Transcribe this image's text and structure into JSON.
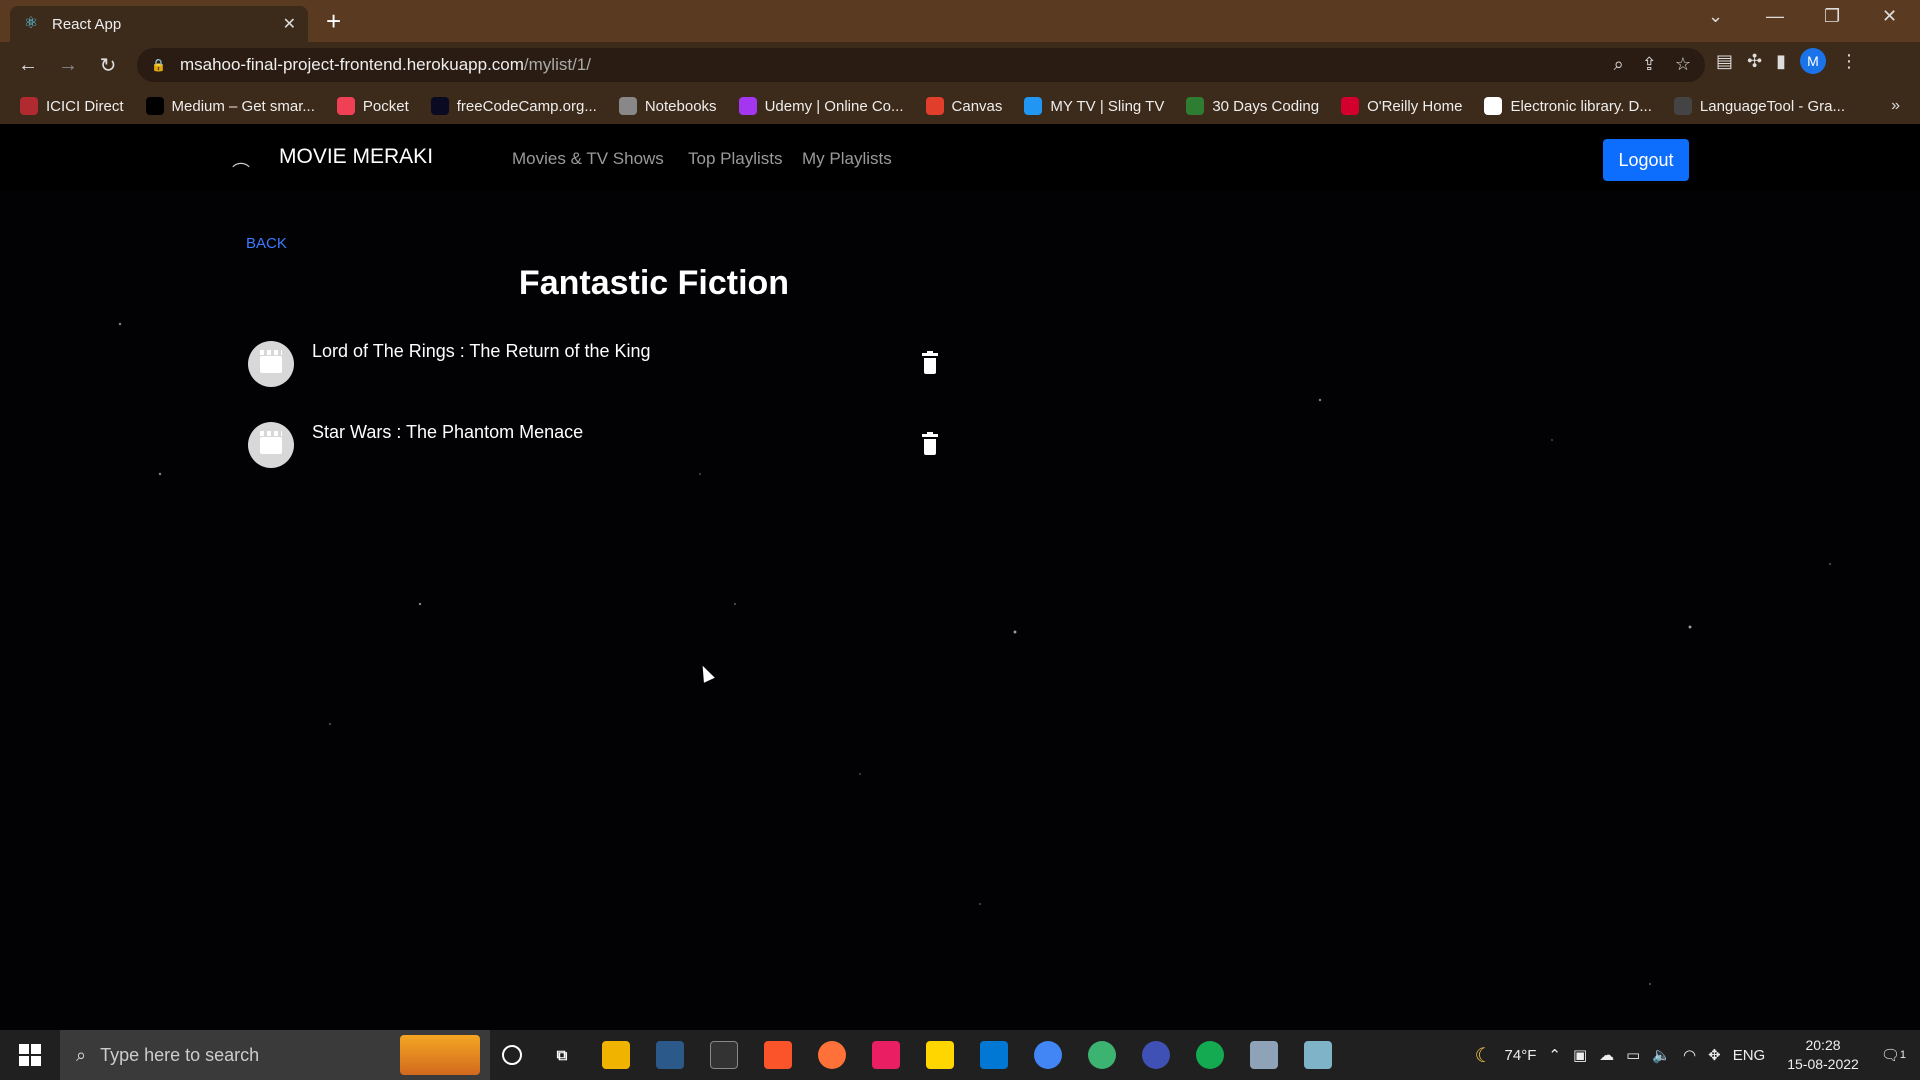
{
  "browser": {
    "tab_title": "React App",
    "url_host": "msahoo-final-project-frontend.herokuapp.com",
    "url_path": "/mylist/1/",
    "profile_initial": "M",
    "bookmarks": [
      {
        "label": "ICICI Direct",
        "icon": "icici-icon",
        "color": "#b02a30"
      },
      {
        "label": "Medium – Get smar...",
        "icon": "medium-icon",
        "color": "#000000"
      },
      {
        "label": "Pocket",
        "icon": "pocket-icon",
        "color": "#ef4056"
      },
      {
        "label": "freeCodeCamp.org...",
        "icon": "freecodecamp-icon",
        "color": "#0a0a23"
      },
      {
        "label": "Notebooks",
        "icon": "notebooks-icon",
        "color": "#888888"
      },
      {
        "label": "Udemy | Online Co...",
        "icon": "udemy-icon",
        "color": "#a435f0"
      },
      {
        "label": "Canvas",
        "icon": "canvas-icon",
        "color": "#e13f2b"
      },
      {
        "label": "MY TV | Sling TV",
        "icon": "sling-icon",
        "color": "#2196f3"
      },
      {
        "label": "30 Days Coding",
        "icon": "coding-icon",
        "color": "#2e7d32"
      },
      {
        "label": "O'Reilly Home",
        "icon": "oreilly-icon",
        "color": "#d3002d"
      },
      {
        "label": "Electronic library. D...",
        "icon": "library-icon",
        "color": "#ffffff"
      },
      {
        "label": "LanguageTool - Gra...",
        "icon": "languagetool-icon",
        "color": "#444444"
      }
    ]
  },
  "app": {
    "brand": "MOVIE MERAKI",
    "nav": [
      "Movies & TV Shows",
      "Top Playlists",
      "My Playlists"
    ],
    "logout_label": "Logout",
    "back_label": "BACK",
    "playlist_title": "Fantastic Fiction",
    "items": [
      {
        "title": "Lord of The Rings : The Return of the King"
      },
      {
        "title": "Star Wars : The Phantom Menace"
      }
    ],
    "accent_color": "#0d6efd"
  },
  "taskbar": {
    "search_placeholder": "Type here to search",
    "temperature": "74°F",
    "language": "ENG",
    "time": "20:28",
    "date": "15-08-2022",
    "notifications": "1"
  }
}
